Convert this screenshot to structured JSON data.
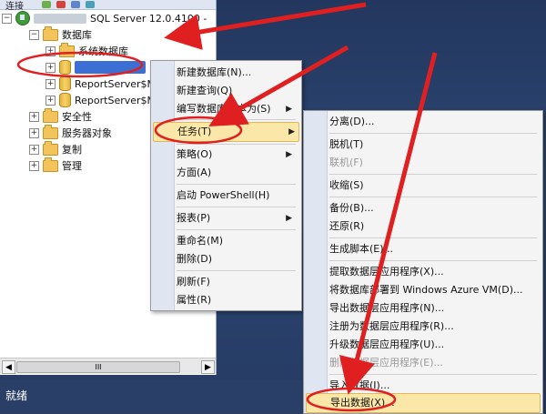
{
  "toolbar": {
    "connect_label": "连接"
  },
  "tree": {
    "server_label": "SQL Server 12.0.4100 -",
    "databases_label": "数据库",
    "system_db_label": "系统数据库",
    "report_server_1": "ReportServer$M",
    "report_server_2": "ReportServer$M",
    "security_label": "安全性",
    "server_objects_label": "服务器对象",
    "replication_label": "复制",
    "management_label": "管理"
  },
  "scrollbar": {
    "thumb_glyph": "III"
  },
  "status": {
    "text": "就绪"
  },
  "menu1": {
    "items": [
      "新建数据库(N)...",
      "新建查询(Q)",
      "编写数据库脚本为(S)",
      "任务(T)",
      "策略(O)",
      "方面(A)",
      "启动 PowerShell(H)",
      "报表(P)",
      "重命名(M)",
      "删除(D)",
      "刷新(F)",
      "属性(R)"
    ]
  },
  "menu2": {
    "items": [
      "分离(D)...",
      "脱机(T)",
      "联机(F)",
      "收缩(S)",
      "备份(B)...",
      "还原(R)",
      "生成脚本(E)...",
      "提取数据层应用程序(X)...",
      "将数据库部署到 Windows Azure VM(D)...",
      "导出数据层应用程序(N)...",
      "注册为数据层应用程序(R)...",
      "升级数据层应用程序(U)...",
      "删除数据层应用程序(E)...",
      "导入数据(I)...",
      "导出数据(X)..."
    ]
  },
  "colors": {
    "annotation": "#e02020",
    "highlight": "#fbe7a7",
    "selection": "#3c6fd3"
  }
}
